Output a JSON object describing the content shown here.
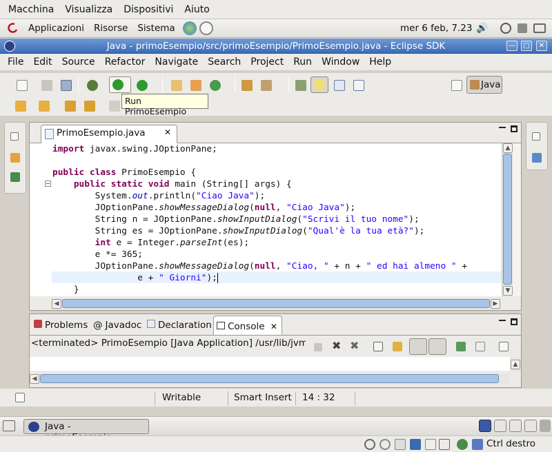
{
  "vbox_menu": [
    "Macchina",
    "Visualizza",
    "Dispositivi",
    "Aiuto"
  ],
  "panel": {
    "menus": [
      "Applicazioni",
      "Risorse",
      "Sistema"
    ],
    "clock": "mer  6 feb, 7.23"
  },
  "window": {
    "title": "Java - primoEsempio/src/primoEsempio/PrimoEsempio.java - Eclipse SDK"
  },
  "menu": [
    "File",
    "Edit",
    "Source",
    "Refactor",
    "Navigate",
    "Search",
    "Project",
    "Run",
    "Window",
    "Help"
  ],
  "toolbar": {
    "tooltip": "Run PrimoEsempio",
    "perspective": "Java"
  },
  "editor": {
    "tab": "PrimoEsempio.java",
    "lines": [
      "import javax.swing.JOptionPane;",
      "",
      "public class PrimoEsempio {",
      "    public static void main (String[] args) {",
      "        System.out.println(\"Ciao Java\");",
      "        JOptionPane.showMessageDialog(null, \"Ciao Java\");",
      "        String n = JOptionPane.showInputDialog(\"Scrivi il tuo nome\");",
      "        String es = JOptionPane.showInputDialog(\"Qual'è la tua età?\");",
      "        int e = Integer.parseInt(es);",
      "        e *= 365;",
      "        JOptionPane.showMessageDialog(null, \"Ciao, \" + n + \" ed hai almeno \" +",
      "                e + \" Giorni\");",
      "    }"
    ]
  },
  "bottom": {
    "tabs": [
      "Problems",
      "Javadoc",
      "Declaration",
      "Console"
    ],
    "console_header": "<terminated> PrimoEsempio [Java Application] /usr/lib/jvm/jav"
  },
  "status": {
    "writable": "Writable",
    "insert_mode": "Smart Insert",
    "position": "14 : 32"
  },
  "taskbar": {
    "item": "Java - primoEsempio..."
  },
  "vbox_status": {
    "host_key": "Ctrl destro"
  },
  "colors": {
    "title_bar": "#3a6bb8",
    "keyword": "#7f0055",
    "string": "#2a00ff",
    "current_line": "#e8f2fe",
    "tooltip": "#ffffe1"
  }
}
